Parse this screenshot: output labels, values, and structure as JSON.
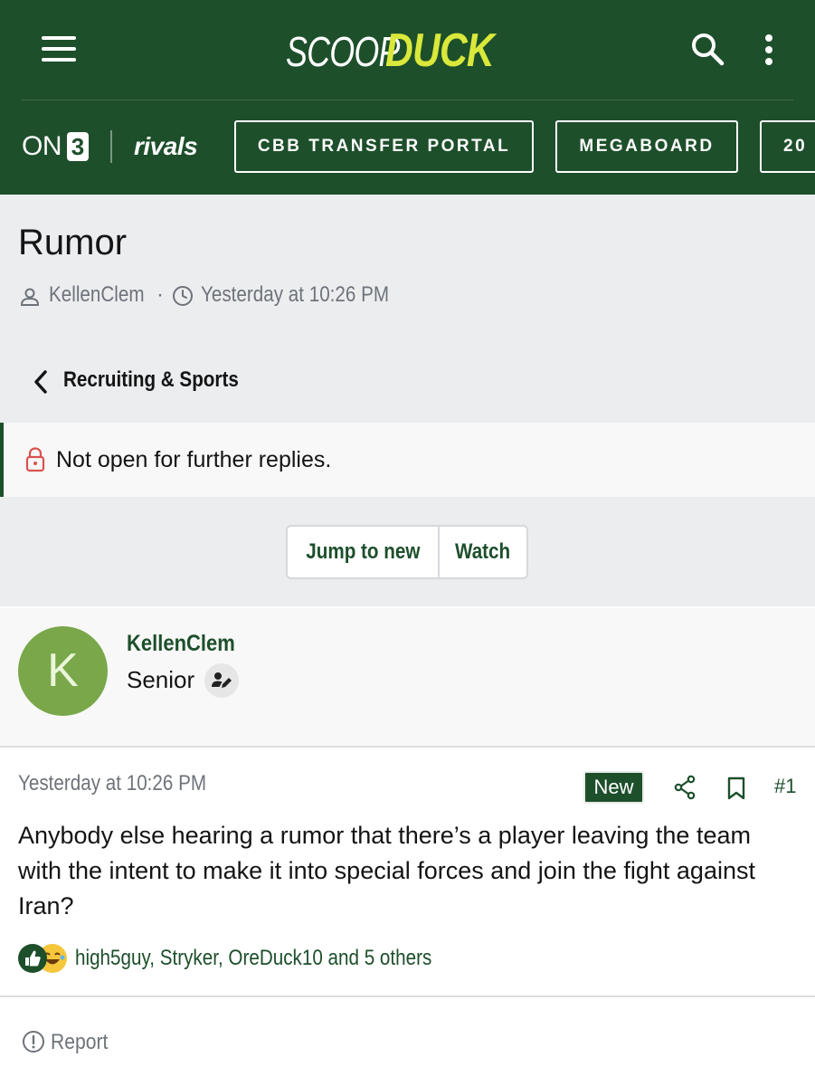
{
  "header": {
    "logo_part1": "SCOOP",
    "logo_part2": "DUCK",
    "brand_left": "ON",
    "brand_three": "3",
    "brand_right": "rivals",
    "nav_pills": [
      "CBB TRANSFER PORTAL",
      "MEGABOARD",
      "20"
    ],
    "colors": {
      "primary": "#1d4f2b",
      "accent": "#d9e83a"
    }
  },
  "thread": {
    "title": "Rumor",
    "author": "KellenClem",
    "separator": "·",
    "timestamp": "Yesterday at 10:26 PM",
    "breadcrumb": "Recruiting & Sports",
    "notice": "Not open for further replies.",
    "actions": {
      "jump_to_new": "Jump to new",
      "watch": "Watch"
    }
  },
  "post": {
    "author_initial": "K",
    "author": "KellenClem",
    "rank": "Senior",
    "date": "Yesterday at 10:26 PM",
    "new_badge": "New",
    "post_number": "#1",
    "body": "Anybody else hearing a rumor that there’s a player leaving the team with the intent to make it into special forces and join the fight against Iran?",
    "reactions_text": "high5guy, Stryker, OreDuck10 and 5 others",
    "report_label": "Report"
  },
  "icons": [
    "menu-icon",
    "search-icon",
    "more-vertical-icon",
    "user-icon",
    "clock-icon",
    "chevron-left-icon",
    "lock-icon",
    "user-edit-icon",
    "share-icon",
    "bookmark-icon",
    "thumbs-up-icon",
    "laughing-icon",
    "report-icon"
  ]
}
